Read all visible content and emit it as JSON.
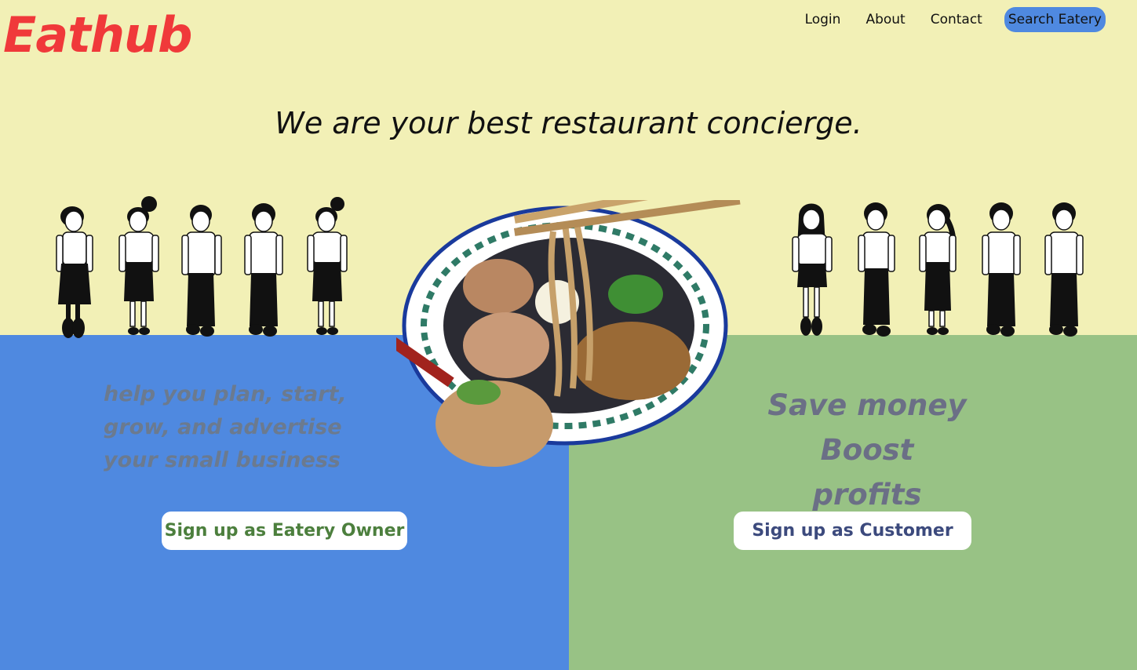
{
  "brand": {
    "logo_text": "Eathub",
    "logo_color": "#f0393a"
  },
  "nav": {
    "login": "Login",
    "about": "About",
    "contact": "Contact",
    "search": "Search Eatery"
  },
  "hero": {
    "tagline": "We are your best restaurant concierge."
  },
  "owner_panel": {
    "pitch": "help you plan, start, grow, and advertise your small business",
    "button": "Sign up as Eatery Owner",
    "background_color": "#4f89e0"
  },
  "customer_panel": {
    "pitch_line_1": "Save money",
    "pitch_line_2": "Boost profits",
    "button": "Sign up as Customer",
    "background_color": "#98c285"
  },
  "colors": {
    "page_background": "#f2f0b6",
    "search_button": "#4f89e0"
  },
  "illustrations": {
    "left_people": [
      "person-short-hair-skirt",
      "person-bun-skirt",
      "person-short-hair-pants",
      "person-short-hair-pants",
      "person-bun-skirt"
    ],
    "right_people": [
      "person-long-hair-skirt",
      "person-short-hair-pants",
      "person-ponytail-skirt",
      "person-short-hair-pants",
      "person-short-hair-pants"
    ],
    "center_image": "ramen-bowl-with-chopsticks"
  }
}
